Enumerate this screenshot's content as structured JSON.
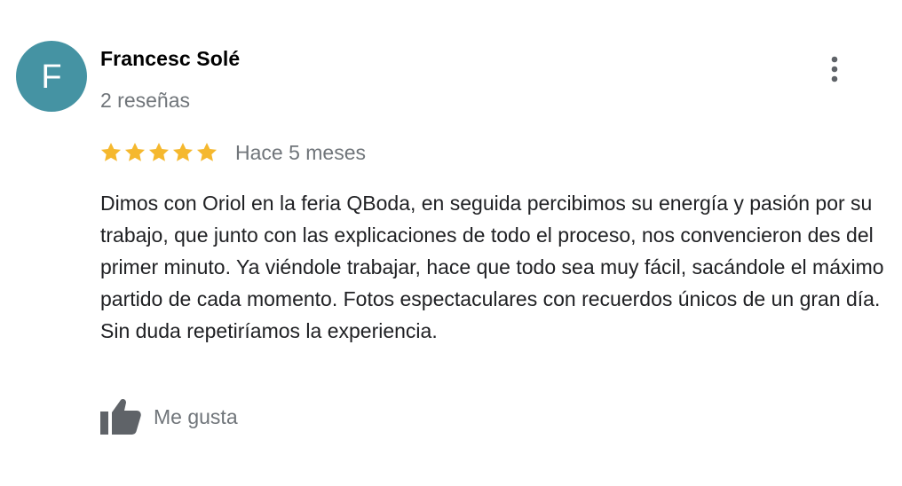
{
  "review": {
    "avatar_letter": "F",
    "author_name": "Francesc Solé",
    "review_count": "2 reseñas",
    "rating": 5,
    "rating_max": 5,
    "date": "Hace 5 meses",
    "text": "Dimos con Oriol en la feria QBoda, en seguida percibimos su energía y pasión por su trabajo, que junto con las explicaciones de todo el proceso, nos convencieron des del primer minuto. Ya viéndole trabajar, hace que todo sea muy fácil, sacándole el máximo partido de cada momento. Fotos espectaculares con recuerdos únicos de un gran día. Sin duda repetiríamos la experiencia.",
    "like_label": "Me gusta"
  },
  "colors": {
    "avatar_bg": "#4593a3",
    "star": "#f5b82e",
    "secondary_text": "#70757a",
    "body_text": "#202124",
    "icon": "#5f6368"
  },
  "icons": {
    "more": "more-vert-icon",
    "star": "star-icon",
    "like": "thumb-up-icon"
  }
}
